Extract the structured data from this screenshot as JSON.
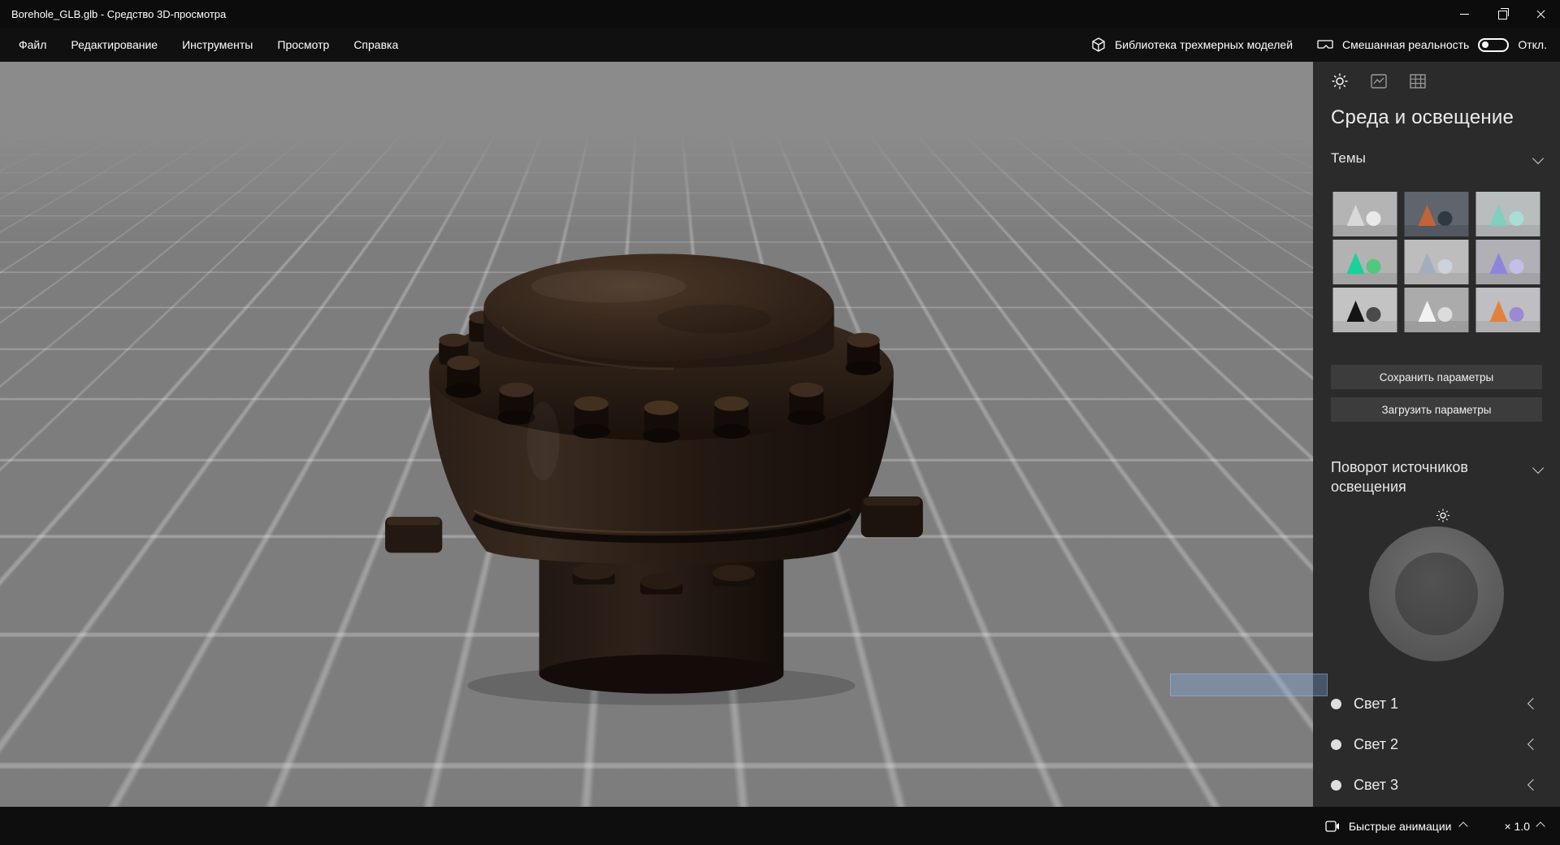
{
  "window": {
    "title": "Borehole_GLB.glb - Средство 3D-просмотра"
  },
  "menu": {
    "items": [
      "Файл",
      "Редактирование",
      "Инструменты",
      "Просмотр",
      "Справка"
    ],
    "library_label": "Библиотека трехмерных моделей",
    "mixed_reality_label": "Смешанная реальность",
    "mixed_reality_state": "Откл."
  },
  "sidebar": {
    "title": "Среда и освещение",
    "themes_label": "Темы",
    "save_button": "Сохранить параметры",
    "load_button": "Загрузить параметры",
    "rotation_label": "Поворот источников освещения",
    "lights": [
      {
        "label": "Свет 1"
      },
      {
        "label": "Свет 2"
      },
      {
        "label": "Свет 3"
      }
    ],
    "themes": [
      {
        "sky": "#b4b4b4",
        "shape1": "#d8d8d8",
        "shape2": "#e9e9e9"
      },
      {
        "sky": "#5f646d",
        "shape1": "#c2633a",
        "shape2": "#2e3a40"
      },
      {
        "sky": "#b9bdbd",
        "shape1": "#7ed0c0",
        "shape2": "#a8ded6"
      },
      {
        "sky": "#b2b2b2",
        "shape1": "#17d29a",
        "shape2": "#52c77e"
      },
      {
        "sky": "#bdbdbd",
        "shape1": "#a3aebc",
        "shape2": "#cdd3da"
      },
      {
        "sky": "#b0b0b6",
        "shape1": "#8d85dd",
        "shape2": "#c4bfe8"
      },
      {
        "sky": "#c3c3c3",
        "shape1": "#141414",
        "shape2": "#4a4a4a"
      },
      {
        "sky": "#ababab",
        "shape1": "#f2f2f2",
        "shape2": "#dcdcdc"
      },
      {
        "sky": "#bfbfc3",
        "shape1": "#e0823e",
        "shape2": "#9b8ad2"
      }
    ]
  },
  "bottom_bar": {
    "quick_animations": "Быстрые анимации",
    "speed": "× 1.0"
  }
}
